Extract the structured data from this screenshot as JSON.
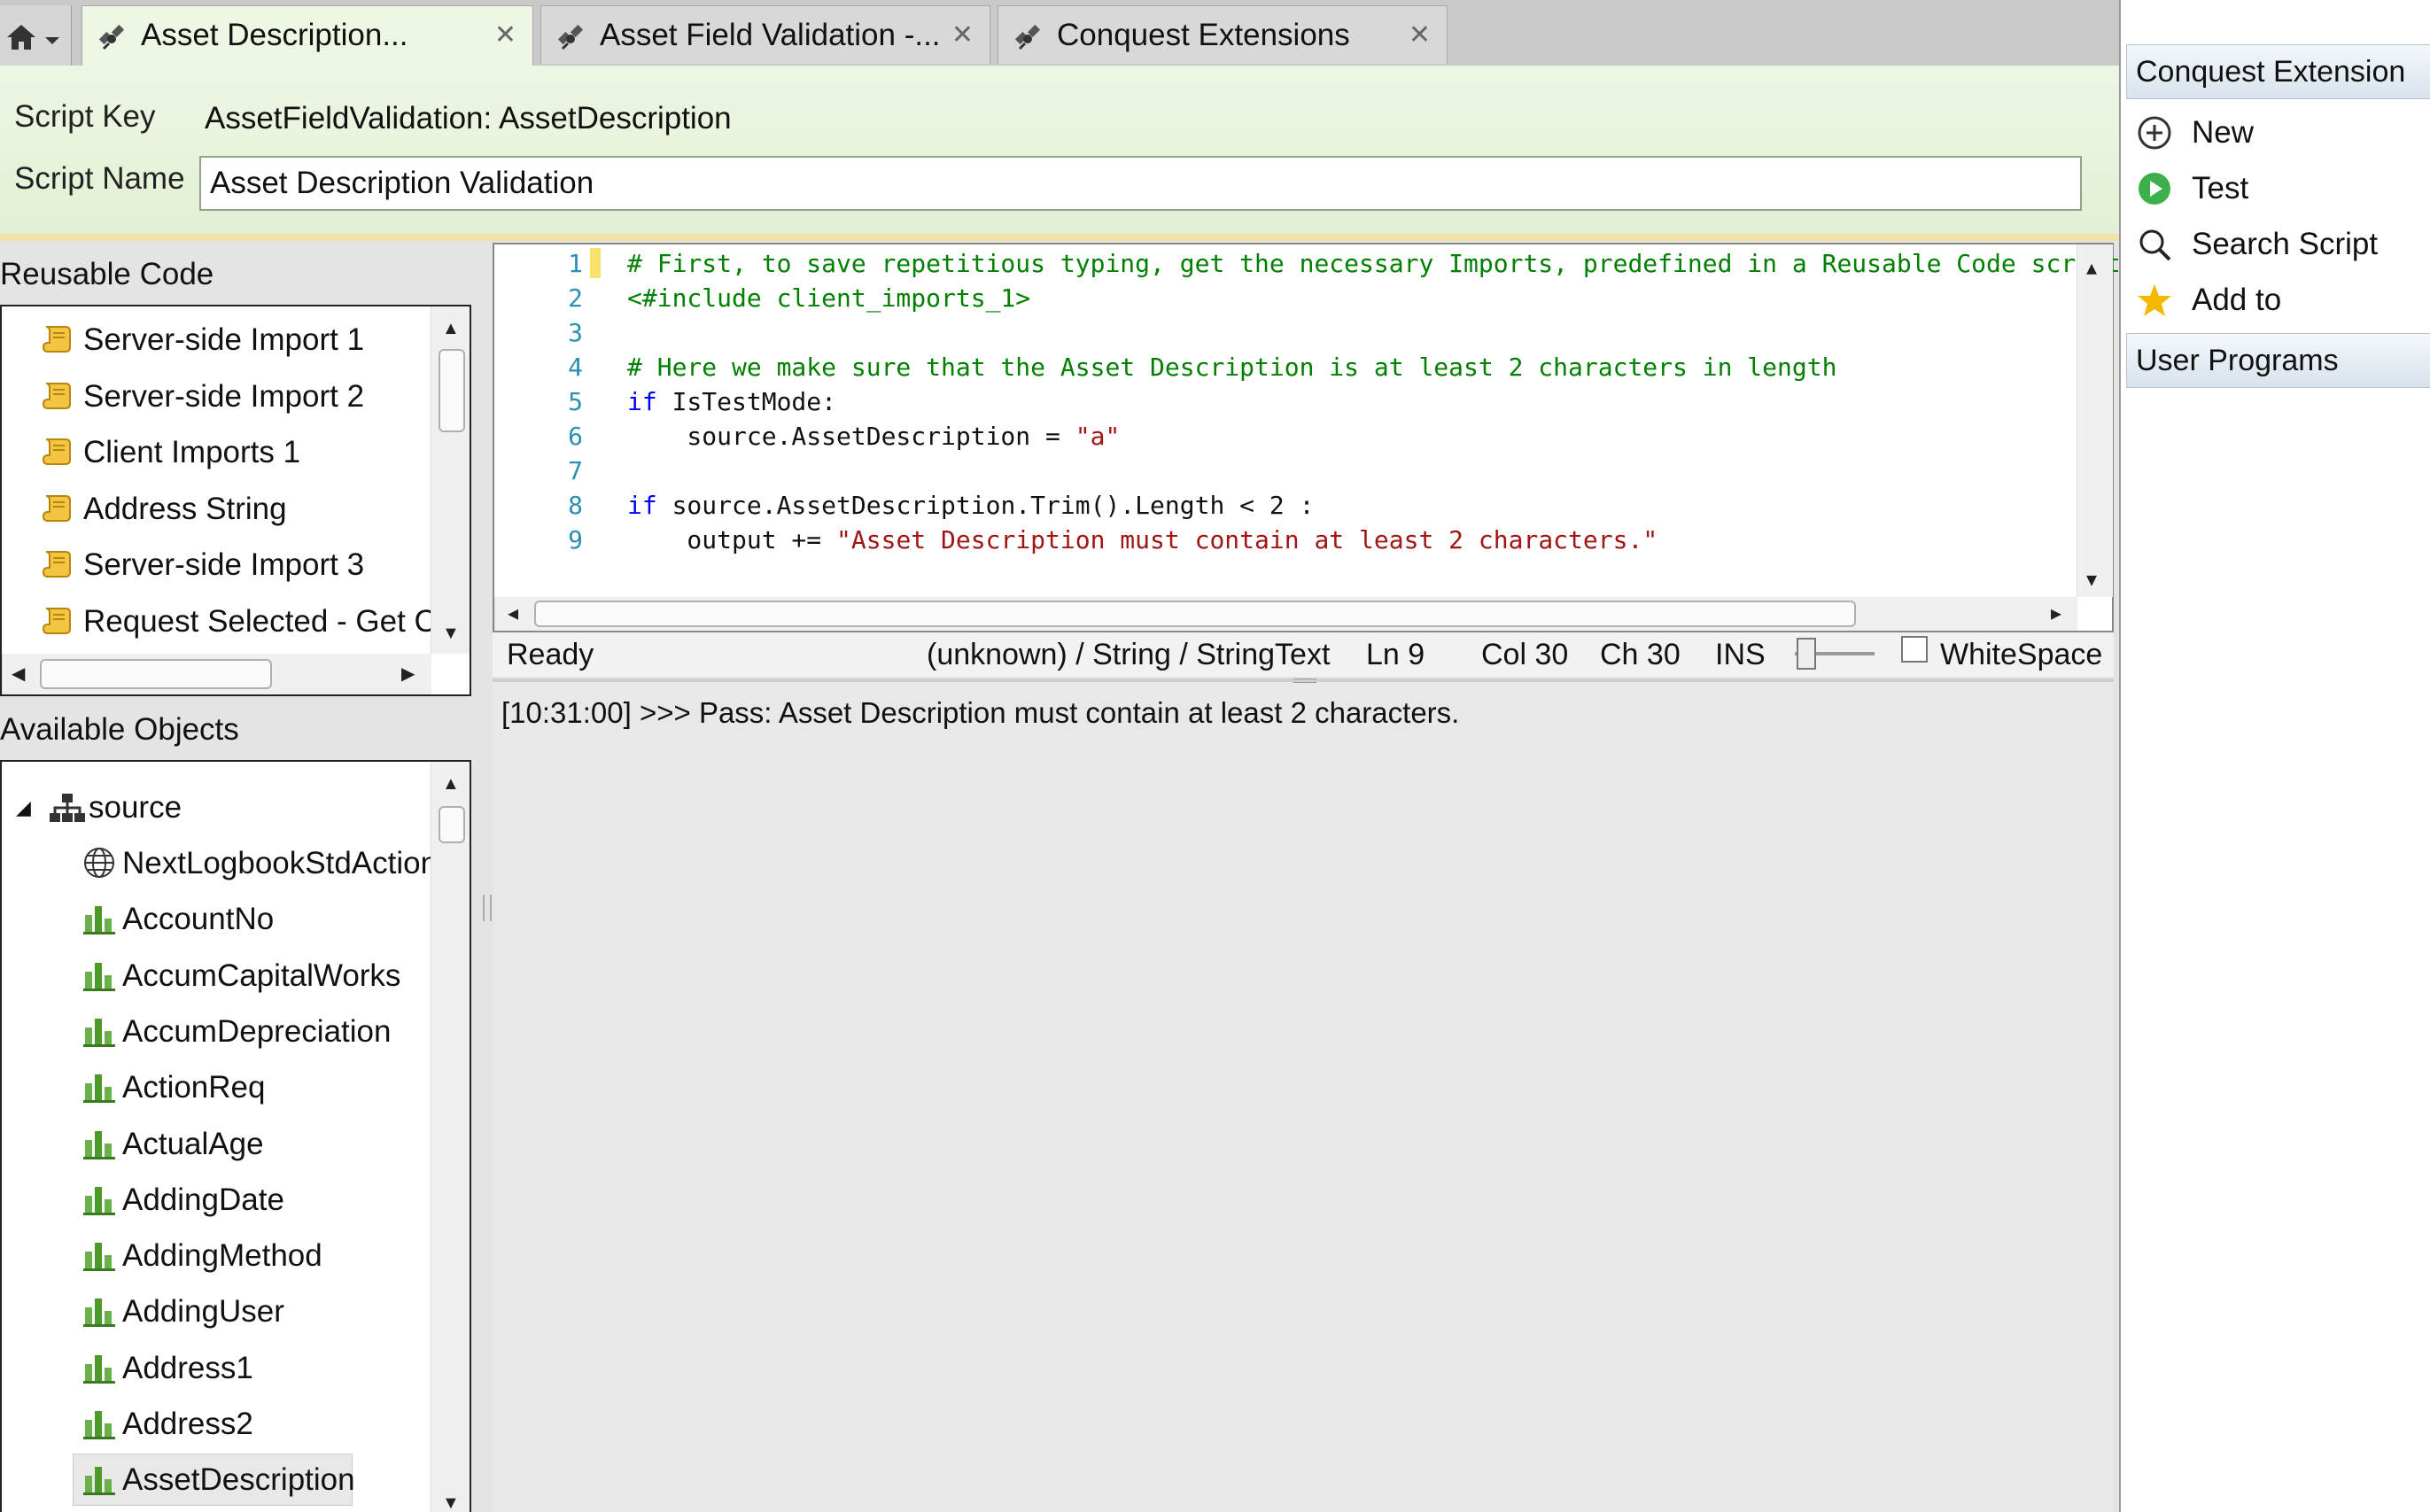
{
  "tabs": [
    {
      "label": "Asset Description...",
      "active": true
    },
    {
      "label": "Asset Field Validation -...",
      "active": false
    },
    {
      "label": "Conquest Extensions",
      "active": false
    }
  ],
  "header": {
    "script_key_label": "Script Key",
    "script_key_value": "AssetFieldValidation: AssetDescription",
    "script_name_label": "Script Name",
    "script_name_value": "Asset Description Validation"
  },
  "reusable_code": {
    "title": "Reusable Code",
    "items": [
      "Server-side Import 1",
      "Server-side Import 2",
      "Client Imports 1",
      "Address String",
      "Server-side Import 3",
      "Request Selected - Get Cu"
    ]
  },
  "available_objects": {
    "title": "Available Objects",
    "root": "source",
    "items": [
      "NextLogbookStdAction",
      "AccountNo",
      "AccumCapitalWorks",
      "AccumDepreciation",
      "ActionReq",
      "ActualAge",
      "AddingDate",
      "AddingMethod",
      "AddingUser",
      "Address1",
      "Address2",
      "AssetDescription"
    ],
    "selected": "AssetDescription"
  },
  "editor": {
    "lines": [
      {
        "n": "1",
        "parts": [
          {
            "t": "# First, to save repetitious typing, get the necessary Imports, predefined in a Reusable Code script",
            "c": "green"
          }
        ]
      },
      {
        "n": "2",
        "parts": [
          {
            "t": "<#include client_imports_1>",
            "c": "green"
          }
        ]
      },
      {
        "n": "3",
        "parts": []
      },
      {
        "n": "4",
        "parts": [
          {
            "t": "# Here we make sure that the Asset Description is at least 2 characters in length",
            "c": "green"
          }
        ]
      },
      {
        "n": "5",
        "parts": [
          {
            "t": "if",
            "c": "blue"
          },
          {
            "t": " IsTestMode:",
            "c": "dark"
          }
        ]
      },
      {
        "n": "6",
        "parts": [
          {
            "t": "    source.AssetDescription = ",
            "c": "dark"
          },
          {
            "t": "\"a\"",
            "c": "red"
          }
        ]
      },
      {
        "n": "7",
        "parts": []
      },
      {
        "n": "8",
        "parts": [
          {
            "t": "if",
            "c": "blue"
          },
          {
            "t": " source.AssetDescription.Trim().Length < 2 :",
            "c": "dark"
          }
        ]
      },
      {
        "n": "9",
        "parts": [
          {
            "t": "    output += ",
            "c": "dark"
          },
          {
            "t": "\"Asset Description must contain at least 2 characters.\"",
            "c": "red"
          }
        ]
      }
    ]
  },
  "status": {
    "ready": "Ready",
    "type_info": "(unknown) / String / StringText",
    "ln": "Ln 9",
    "col": "Col 30",
    "ch": "Ch 30",
    "mode": "INS",
    "whitespace_label": "WhiteSpace"
  },
  "output": {
    "text": "[10:31:00] >>> Pass: Asset Description must contain at least 2 characters."
  },
  "right_panel": {
    "title": "Conquest Extension",
    "items": [
      {
        "label": "New",
        "icon": "plus-circle-icon"
      },
      {
        "label": "Test",
        "icon": "play-icon"
      },
      {
        "label": "Search Script",
        "icon": "search-icon"
      },
      {
        "label": "Add to Favourites",
        "icon": "star-icon"
      }
    ],
    "section2": "User Programs"
  },
  "colors": {
    "header_green": "#e3f0d4",
    "comment": "#008000",
    "keyword": "#0000ff",
    "string": "#a31515",
    "line_number": "#2b91af"
  }
}
